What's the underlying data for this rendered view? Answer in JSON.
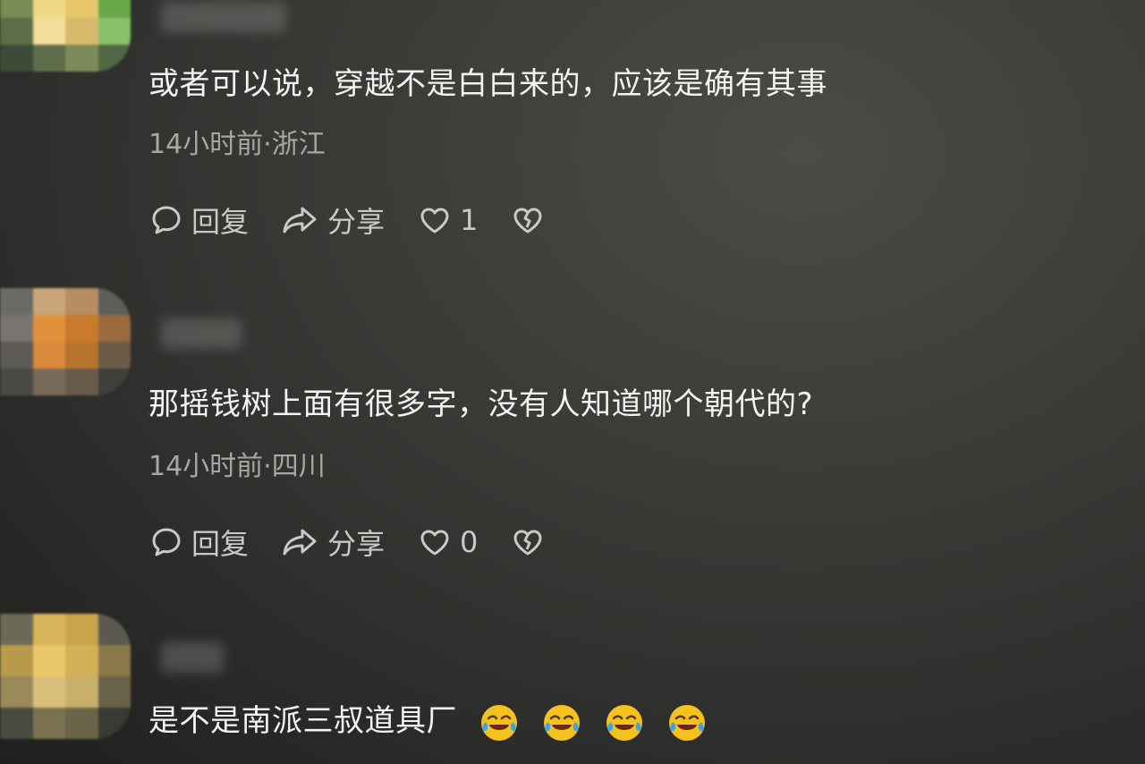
{
  "comments": [
    {
      "text": "或者可以说，穿越不是白白来的，应该是确有其事",
      "time": "14小时前",
      "location": "浙江",
      "meta": "14小时前·浙江",
      "actions": {
        "reply": "回复",
        "share": "分享",
        "likes": "1"
      }
    },
    {
      "text": "那摇钱树上面有很多字，没有人知道哪个朝代的?",
      "time": "14小时前",
      "location": "四川",
      "meta": "14小时前·四川",
      "actions": {
        "reply": "回复",
        "share": "分享",
        "likes": "0"
      }
    },
    {
      "text": "是不是南派三叔道具厂",
      "emojis": [
        "laughing-tears-emoji",
        "laughing-tears-emoji",
        "laughing-tears-emoji",
        "laughing-tears-emoji"
      ]
    }
  ],
  "colors": {
    "background": "#3a3b37",
    "text": "#f4f4f2",
    "meta": "#a7a8a3",
    "icon": "#c9cac6",
    "emoji_face": "#f5c11e",
    "emoji_tear": "#3aa6e8"
  },
  "icons": {
    "reply": "comment-bubble-icon",
    "share": "share-arrow-icon",
    "like": "heart-icon",
    "dislike": "broken-heart-icon"
  }
}
